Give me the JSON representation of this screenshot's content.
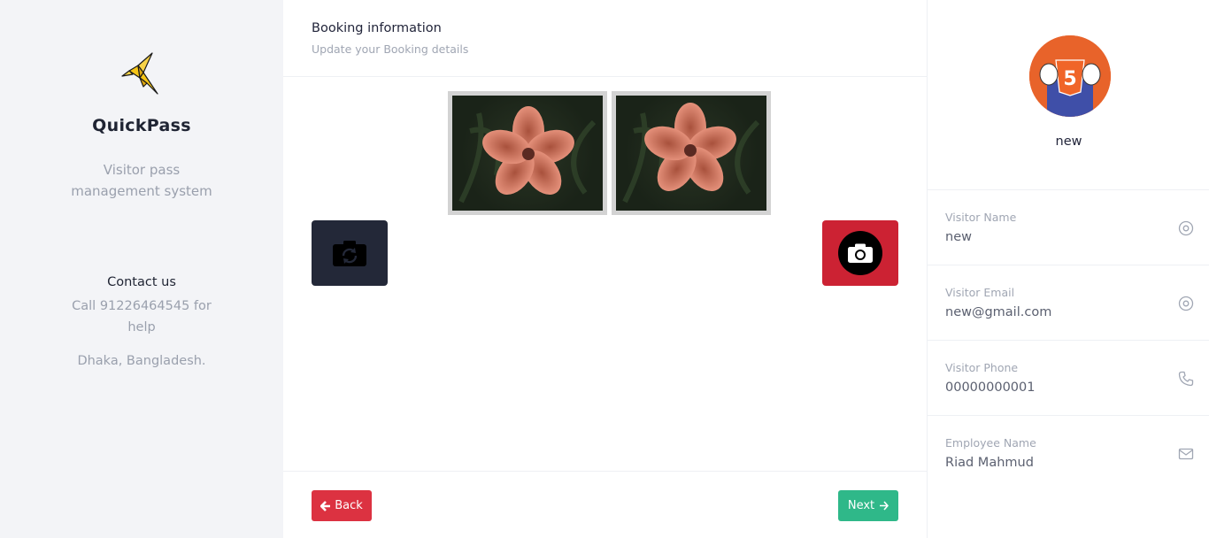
{
  "sidebar": {
    "brand": "QuickPass",
    "tagline": "Visitor pass management system",
    "contact_title": "Contact us",
    "contact_text": "Call 91226464545 for help",
    "address": "Dhaka, Bangladesh."
  },
  "main": {
    "title": "Booking information",
    "subtitle": "Update your Booking details",
    "back_label": "Back",
    "next_label": "Next",
    "icons": {
      "switch_camera": "camera-switch-icon",
      "capture": "camera-icon",
      "back": "arrow-left-icon",
      "next": "arrow-right-icon"
    }
  },
  "profile": {
    "name": "new",
    "fields": [
      {
        "label": "Visitor Name",
        "value": "new",
        "icon": "target-icon"
      },
      {
        "label": "Visitor Email",
        "value": "new@gmail.com",
        "icon": "target-icon"
      },
      {
        "label": "Visitor Phone",
        "value": "00000000001",
        "icon": "phone-icon"
      },
      {
        "label": "Employee Name",
        "value": "Riad Mahmud",
        "icon": "mail-icon"
      }
    ]
  },
  "colors": {
    "sidebar_bg": "#f3f4f7",
    "danger": "#dc3241",
    "success": "#2fb889",
    "dark": "#232838",
    "capture": "#cc2233"
  }
}
